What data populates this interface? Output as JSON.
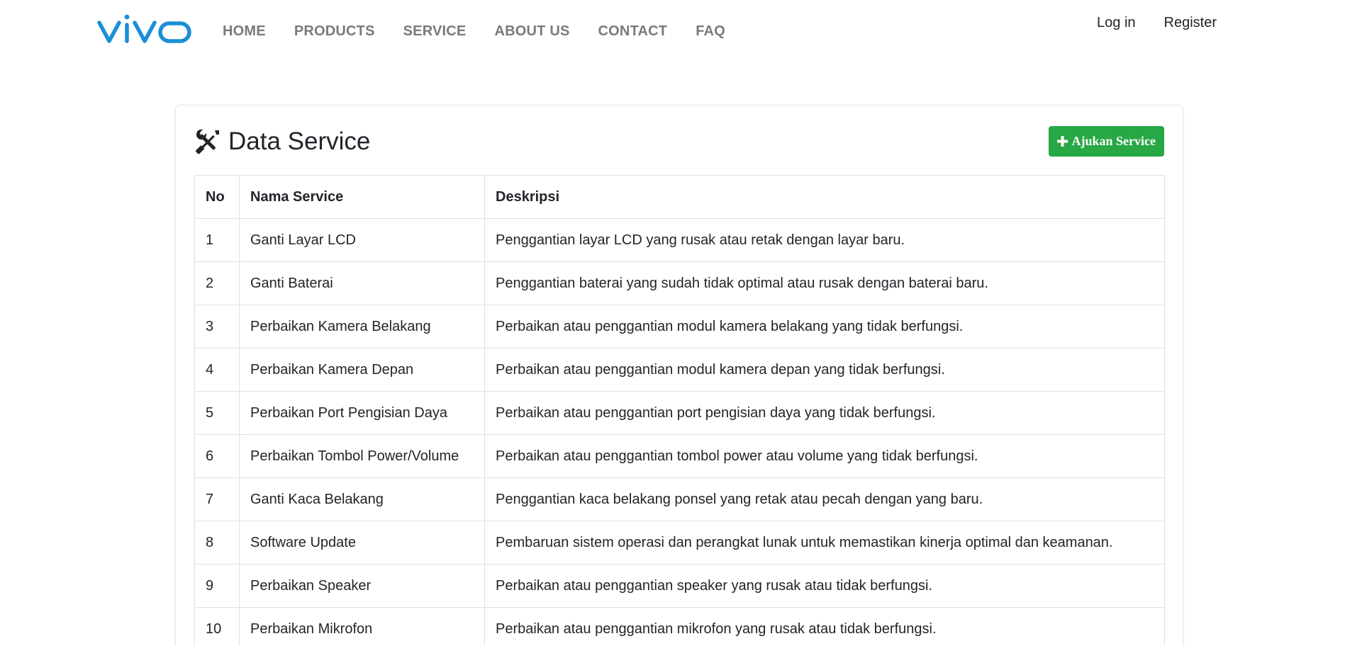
{
  "brand": {
    "logo_text": "vivo",
    "color": "#1a8fd6"
  },
  "nav": {
    "items": [
      {
        "label": "HOME"
      },
      {
        "label": "PRODUCTS"
      },
      {
        "label": "SERVICE"
      },
      {
        "label": "ABOUT US"
      },
      {
        "label": "CONTACT"
      },
      {
        "label": "FAQ"
      }
    ],
    "login_label": "Log in",
    "register_label": "Register"
  },
  "main": {
    "title": "Data Service",
    "title_icon": "tools-icon",
    "add_button": {
      "label": "Ajukan Service",
      "icon": "plus-icon",
      "color": "#28a745"
    }
  },
  "table": {
    "headers": {
      "no": "No",
      "name": "Nama Service",
      "desc": "Deskripsi"
    },
    "rows": [
      {
        "no": "1",
        "name": "Ganti Layar LCD",
        "desc": "Penggantian layar LCD yang rusak atau retak dengan layar baru."
      },
      {
        "no": "2",
        "name": "Ganti Baterai",
        "desc": "Penggantian baterai yang sudah tidak optimal atau rusak dengan baterai baru."
      },
      {
        "no": "3",
        "name": "Perbaikan Kamera Belakang",
        "desc": "Perbaikan atau penggantian modul kamera belakang yang tidak berfungsi."
      },
      {
        "no": "4",
        "name": "Perbaikan Kamera Depan",
        "desc": "Perbaikan atau penggantian modul kamera depan yang tidak berfungsi."
      },
      {
        "no": "5",
        "name": "Perbaikan Port Pengisian Daya",
        "desc": "Perbaikan atau penggantian port pengisian daya yang tidak berfungsi."
      },
      {
        "no": "6",
        "name": "Perbaikan Tombol Power/Volume",
        "desc": "Perbaikan atau penggantian tombol power atau volume yang tidak berfungsi."
      },
      {
        "no": "7",
        "name": "Ganti Kaca Belakang",
        "desc": "Penggantian kaca belakang ponsel yang retak atau pecah dengan yang baru."
      },
      {
        "no": "8",
        "name": "Software Update",
        "desc": "Pembaruan sistem operasi dan perangkat lunak untuk memastikan kinerja optimal dan keamanan."
      },
      {
        "no": "9",
        "name": "Perbaikan Speaker",
        "desc": "Perbaikan atau penggantian speaker yang rusak atau tidak berfungsi."
      },
      {
        "no": "10",
        "name": "Perbaikan Mikrofon",
        "desc": "Perbaikan atau penggantian mikrofon yang rusak atau tidak berfungsi."
      }
    ]
  }
}
